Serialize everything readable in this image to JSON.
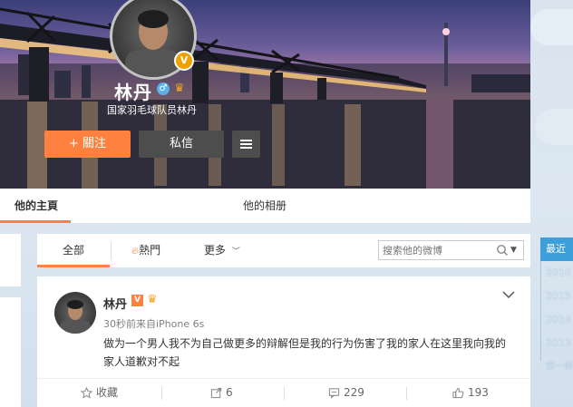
{
  "profile": {
    "name": "林丹",
    "description": "国家羽毛球队员林丹",
    "verified_badge": "V",
    "gender_icon": "male-icon",
    "follow_label": "+ 關注",
    "message_label": "私信"
  },
  "tabs": {
    "home": "他的主頁",
    "album": "他的相册"
  },
  "feed_filter": {
    "all": "全部",
    "hot": "熱門",
    "more": "更多",
    "search_placeholder": "搜索他的微博"
  },
  "post": {
    "author": "林丹",
    "verified": "V",
    "meta": "30秒前来自iPhone 6s",
    "text": "做为一个男人我不为自己做更多的辩解但是我的行为伤害了我的家人在这里我向我的家人道歉对不起",
    "actions": {
      "favorite": "收藏",
      "share": "6",
      "comment": "229",
      "like": "193"
    }
  },
  "year_nav": {
    "recent": "最近",
    "years": [
      "2016",
      "2015",
      "2014",
      "2013"
    ],
    "first": "第一條"
  },
  "colors": {
    "accent": "#ff8140",
    "dark_button": "#4d4d4d",
    "year_active": "#3d9fd9"
  }
}
